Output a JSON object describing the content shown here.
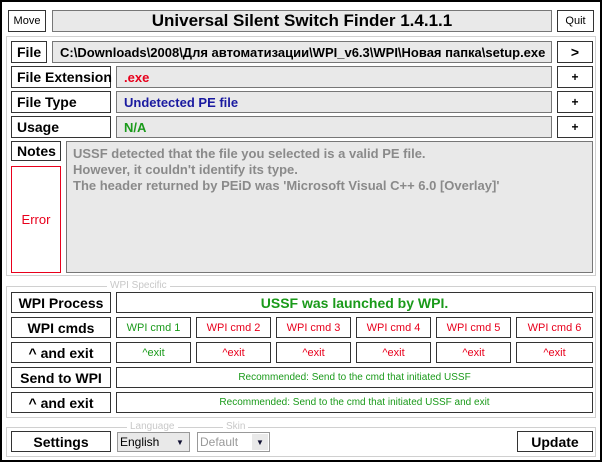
{
  "header": {
    "move": "Move",
    "title": "Universal Silent Switch Finder 1.4.1.1",
    "quit": "Quit"
  },
  "file": {
    "label": "File",
    "path": "C:\\Downloads\\2008\\Для автоматизации\\WPI_v6.3\\WPI\\Новая папка\\setup.exe",
    "browse": ">"
  },
  "extension": {
    "label": "File Extension",
    "value": ".exe",
    "plus": "+"
  },
  "type": {
    "label": "File Type",
    "value": "Undetected PE file",
    "plus": "+"
  },
  "usage": {
    "label": "Usage",
    "value": "N/A",
    "plus": "+"
  },
  "notes": {
    "label": "Notes",
    "status": "Error",
    "lines": [
      "USSF detected that the file you selected is a valid PE file.",
      "However, it couldn't identify its type.",
      "The header returned by PEiD was 'Microsoft Visual C++ 6.0 [Overlay]'"
    ]
  },
  "wpi": {
    "group_label": "WPI Specific",
    "process_label": "WPI Process",
    "process_value": "USSF was launched by WPI.",
    "cmds_label": "WPI cmds",
    "cmds": [
      "WPI cmd 1",
      "WPI cmd 2",
      "WPI cmd 3",
      "WPI cmd 4",
      "WPI cmd 5",
      "WPI cmd 6"
    ],
    "exit_label": "^ and exit",
    "exits": [
      "^exit",
      "^exit",
      "^exit",
      "^exit",
      "^exit",
      "^exit"
    ],
    "send_label": "Send to WPI",
    "send_value": "Recommended: Send to the cmd that initiated USSF",
    "send_exit_label": "^ and exit",
    "send_exit_value": "Recommended: Send to the cmd that initiated USSF and exit"
  },
  "bottom": {
    "settings": "Settings",
    "language_label": "Language",
    "language": "English",
    "skin_label": "Skin",
    "skin": "Default",
    "update": "Update"
  },
  "colors": {
    "red": "#e8001c",
    "blue": "#1a1aa0",
    "green": "#1a9a1a",
    "gray_text": "#8a8a8a"
  }
}
